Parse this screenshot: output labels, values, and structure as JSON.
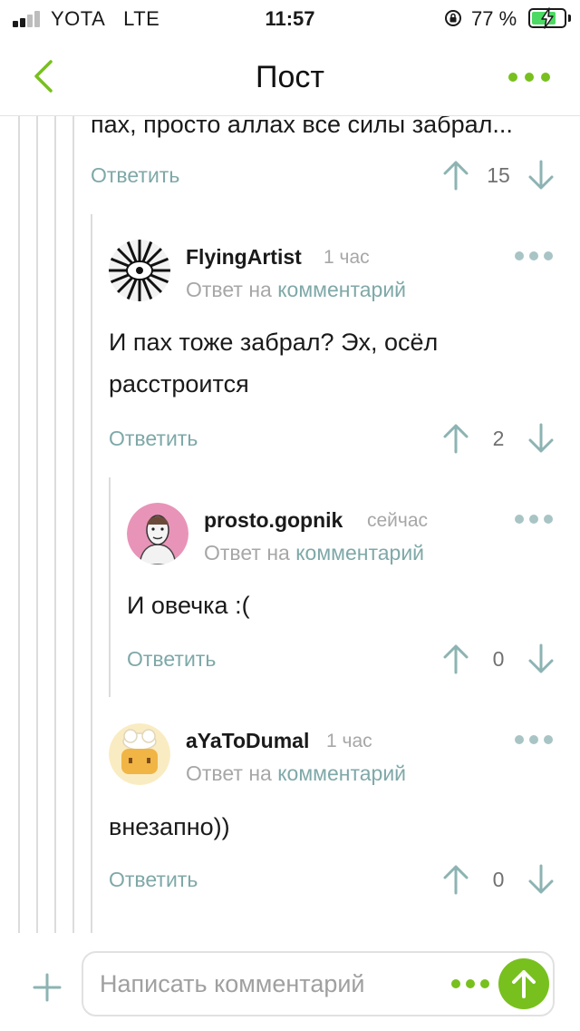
{
  "status_bar": {
    "carrier": "YOTA",
    "network": "LTE",
    "time": "11:57",
    "battery_percent": "77 %",
    "battery_level": 0.77
  },
  "header": {
    "title": "Пост",
    "accent_color": "#78c01e"
  },
  "comments": [
    {
      "text": "пах, просто аллах все силы забрал...",
      "reply_label": "Ответить",
      "score": "15"
    },
    {
      "username": "FlyingArtist",
      "timestamp": "1 час",
      "reply_to_prefix": "Ответ на",
      "reply_to_link": "комментарий",
      "text_lines": [
        "И пах тоже забрал? Эх, осёл",
        "расстроится"
      ],
      "reply_label": "Ответить",
      "score": "2"
    },
    {
      "username": "prosto.gopnik",
      "timestamp": "сейчас",
      "reply_to_prefix": "Ответ на",
      "reply_to_link": "комментарий",
      "text": "И овечка :(",
      "reply_label": "Ответить",
      "score": "0"
    },
    {
      "username": "aYaToDumal",
      "timestamp": "1 час",
      "reply_to_prefix": "Ответ на",
      "reply_to_link": "комментарий",
      "text": "внезапно))",
      "reply_label": "Ответить",
      "score": "0"
    }
  ],
  "composer": {
    "placeholder": "Написать комментарий"
  },
  "icons": [
    "back-icon",
    "more-icon",
    "arrow-up-icon",
    "arrow-down-icon",
    "plus-icon",
    "send-icon",
    "lock-rotation-icon",
    "battery-icon",
    "signal-icon"
  ]
}
